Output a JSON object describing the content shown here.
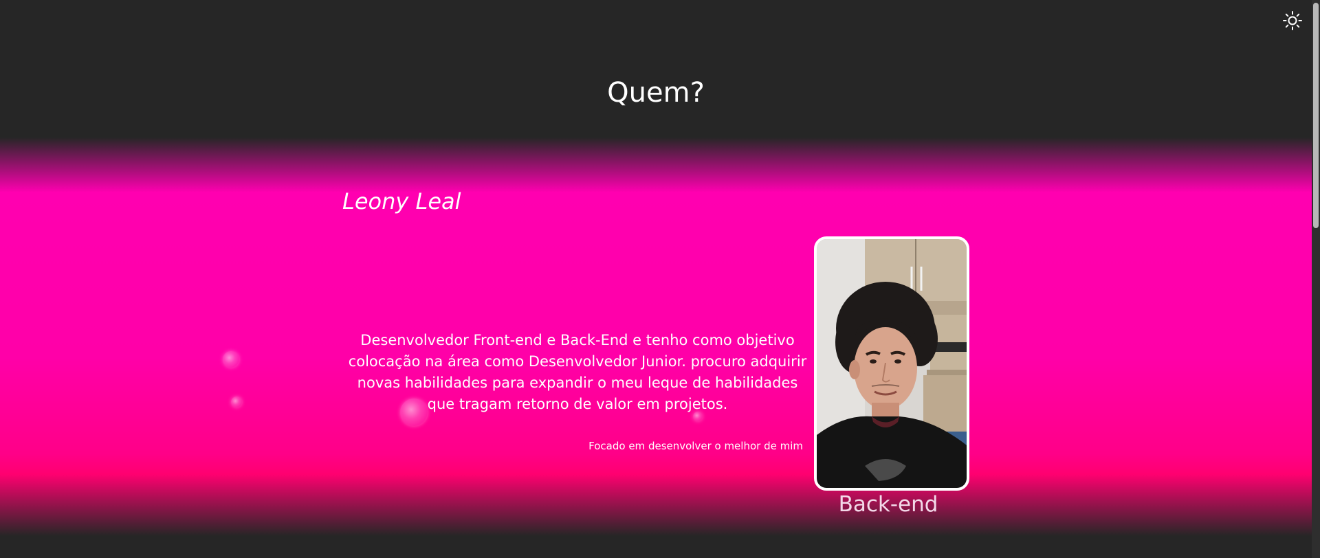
{
  "header": {
    "title": "Quem?",
    "theme_toggle_icon": "sun-icon"
  },
  "profile": {
    "name": "Leony Leal",
    "description": "Desenvolvedor Front-end e Back-End e tenho como objetivo colocação na área como Desenvolvedor Junior. procuro adquirir novas habilidades para expandir o meu leque de habilidades que tragam retorno de valor em projetos.",
    "tagline": "Focado em desenvolver o melhor de mim",
    "role": "Back-end",
    "photo_icon": "profile-photo"
  },
  "colors": {
    "background": "#262626",
    "accent": "#ff00a8",
    "text": "#ffffff"
  }
}
